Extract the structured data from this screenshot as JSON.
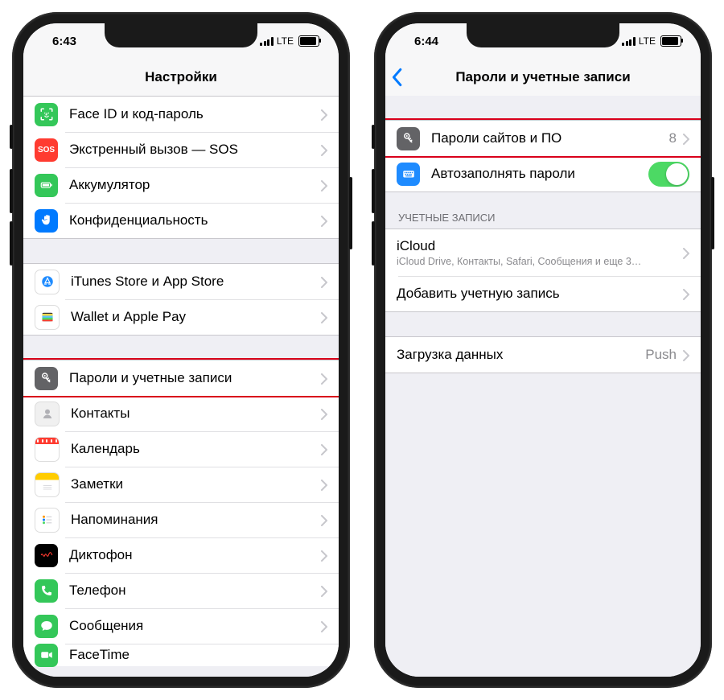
{
  "phoneA": {
    "status": {
      "time": "6:43",
      "carrier": "LTE"
    },
    "nav": {
      "title": "Настройки"
    },
    "rows": {
      "faceid": "Face ID и код-пароль",
      "sos": "Экстренный вызов — SOS",
      "battery": "Аккумулятор",
      "privacy": "Конфиденциальность",
      "itunes": "iTunes Store и App Store",
      "wallet": "Wallet и Apple Pay",
      "passwords": "Пароли и учетные записи",
      "contacts": "Контакты",
      "calendar": "Календарь",
      "notes": "Заметки",
      "reminders": "Напоминания",
      "voicememos": "Диктофон",
      "phone": "Телефон",
      "messages": "Сообщения",
      "facetime": "FaceTime"
    }
  },
  "phoneB": {
    "status": {
      "time": "6:44",
      "carrier": "LTE"
    },
    "nav": {
      "title": "Пароли и учетные записи"
    },
    "rows": {
      "site_passwords": "Пароли сайтов и ПО",
      "site_passwords_count": "8",
      "autofill": "Автозаполнять пароли",
      "section_accounts": "УЧЕТНЫЕ ЗАПИСИ",
      "icloud": "iCloud",
      "icloud_detail": "iCloud Drive, Контакты, Safari, Сообщения и еще 3…",
      "add_account": "Добавить учетную запись",
      "fetch": "Загрузка данных",
      "fetch_value": "Push"
    }
  }
}
